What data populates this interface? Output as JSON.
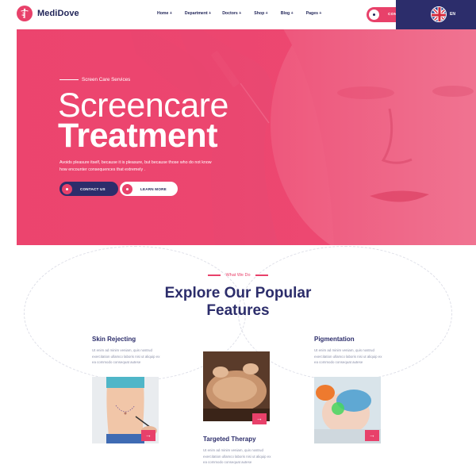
{
  "brand": {
    "name": "MediDove"
  },
  "nav": {
    "items": [
      "Home +",
      "Department +",
      "Doctors +",
      "Shop +",
      "Blog +",
      "Pages +"
    ]
  },
  "header": {
    "cta_label": "CONTACT US",
    "lang": "EN"
  },
  "hero": {
    "kicker": "Screen Care Services",
    "title_line1": "Screencare",
    "title_line2": "Treatment",
    "description": "Avoids pleasure itself, because it is pleasure, but because those who do not know how encounter consequences that extremely .",
    "btn_contact": "CONTACT US",
    "btn_learn": "LEARN MORE"
  },
  "features": {
    "kicker": "What We Do",
    "title_line1": "Explore Our Popular",
    "title_line2": "Features",
    "cards": [
      {
        "title": "Skin Rejecting",
        "text": "Ut enim ad minim veniam, quis nostrud exercitation ullamco laboris nisi ut aliquip ex ea commodo consequat autese"
      },
      {
        "title": "Targeted Therapy",
        "text": "Ut enim ad minim veniam, quis nostrud exercitation ullamco laboris nisi ut aliquip ex ea commodo consequat autese"
      },
      {
        "title": "Pigmentation",
        "text": "Ut enim ad minim veniam, quis nostrud exercitation ullamco laboris nisi ut aliquip ex ea commodo consequat autese"
      }
    ],
    "arrow_glyph": "→"
  },
  "colors": {
    "accent": "#e8416a",
    "navy": "#2c2d6b",
    "hero_bg": "#ef5279"
  },
  "icons": [
    "caduceus-icon",
    "uk-flag-icon",
    "arrow-right-icon"
  ]
}
